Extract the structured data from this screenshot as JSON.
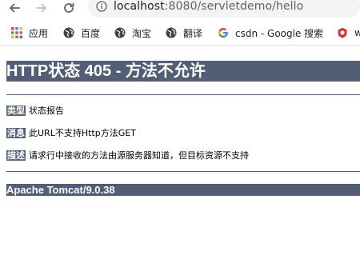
{
  "browser": {
    "url_host": "localhost",
    "url_rest": ":8080/servletdemo/hello",
    "icons": {
      "back": "arrow-left-icon",
      "forward": "arrow-right-icon",
      "reload": "reload-icon",
      "info": "info-icon"
    }
  },
  "bookmarks": [
    {
      "label": "应用",
      "icon": "apps-grid-icon"
    },
    {
      "label": "百度",
      "icon": "globe-icon"
    },
    {
      "label": "淘宝",
      "icon": "globe-icon"
    },
    {
      "label": "翻译",
      "icon": "globe-icon"
    },
    {
      "label": "csdn - Google 搜索",
      "icon": "google-icon"
    },
    {
      "label": "w",
      "icon": "shield-logo-icon"
    }
  ],
  "page": {
    "title": "HTTP状态 405 - 方法不允许",
    "rows": [
      {
        "tag": "类型",
        "text": "状态报告"
      },
      {
        "tag": "消息",
        "text": "此URL不支持Http方法GET"
      },
      {
        "tag": "描述",
        "text": "请求行中接收的方法由源服务器知道，但目标资源不支持"
      }
    ],
    "footer": "Apache Tomcat/9.0.38"
  },
  "colors": {
    "tomcat_bar": "#525d76",
    "omnibox_bg": "#f1f3f4"
  }
}
